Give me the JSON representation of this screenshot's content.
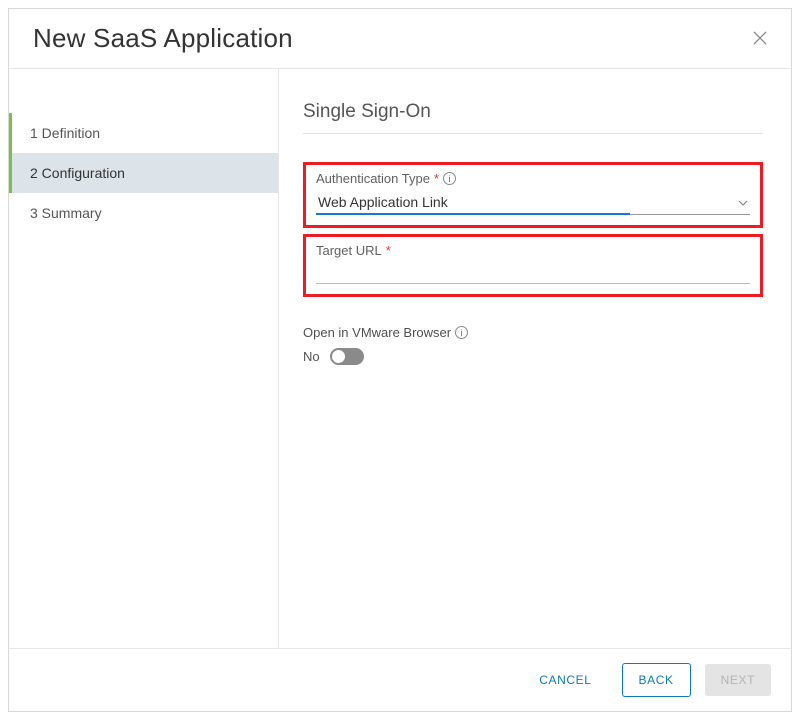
{
  "dialog": {
    "title": "New SaaS Application"
  },
  "steps": [
    {
      "label": "1  Definition"
    },
    {
      "label": "2  Configuration"
    },
    {
      "label": "3  Summary"
    }
  ],
  "section": {
    "title": "Single Sign-On",
    "auth_type_label": "Authentication Type",
    "auth_type_value": "Web Application Link",
    "target_url_label": "Target URL",
    "target_url_value": "",
    "open_browser_label": "Open in VMware Browser",
    "open_browser_value": "No"
  },
  "footer": {
    "cancel": "CANCEL",
    "back": "BACK",
    "next": "NEXT"
  }
}
